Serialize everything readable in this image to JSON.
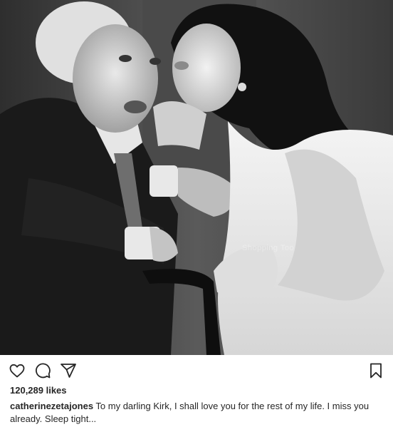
{
  "post": {
    "photo_alt": "",
    "watermark": "Shopping Too",
    "likes": "120,289 likes",
    "username": "catherinezetajones",
    "caption": " To my darling Kirk, I shall love you for the rest of my life. I miss you already. Sleep tight..."
  },
  "icons": {
    "like": "heart-icon",
    "comment": "comment-icon",
    "share": "share-icon",
    "save": "bookmark-icon"
  },
  "colors": {
    "text": "#262626",
    "background": "#ffffff"
  }
}
